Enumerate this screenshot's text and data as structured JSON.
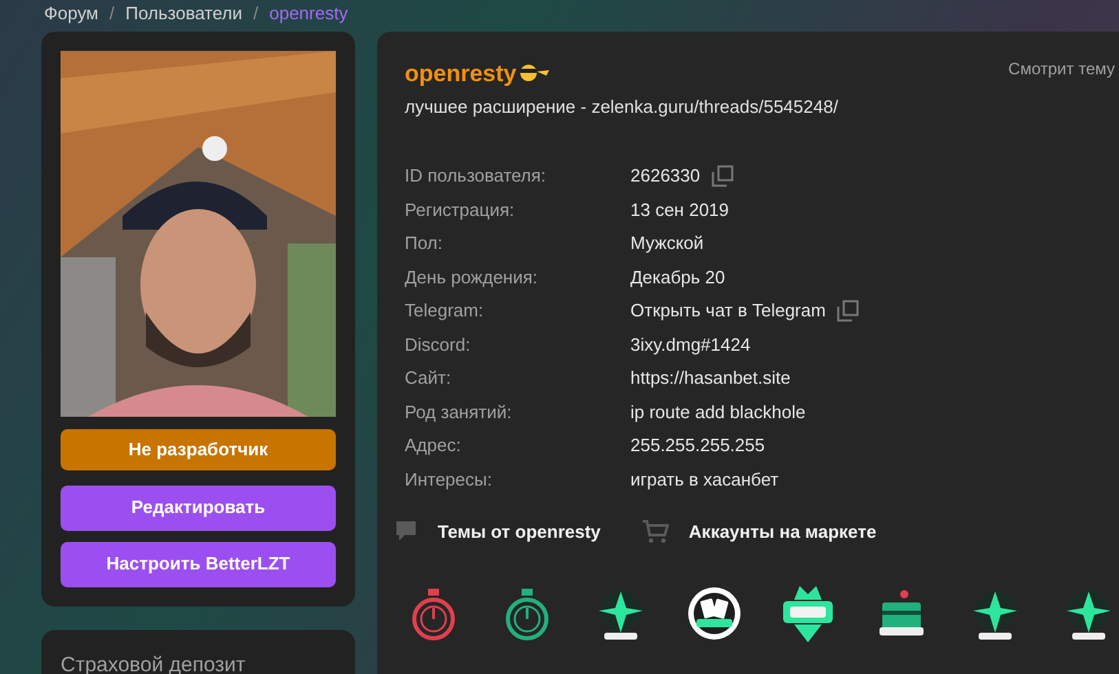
{
  "breadcrumb_separator": "/",
  "breadcrumbs": [
    {
      "label": "Форум",
      "selected": false
    },
    {
      "label": "Пользователи",
      "selected": false
    },
    {
      "label": "openresty",
      "selected": true
    }
  ],
  "sidebar": {
    "buttons": [
      {
        "label": "Не разработчик",
        "kind": "orange"
      },
      {
        "label": "Редактировать",
        "kind": "purple"
      },
      {
        "label": "Настроить BetterLZT",
        "kind": "purple"
      }
    ],
    "deposit_title": "Страховой депозит"
  },
  "profile": {
    "username": "openresty",
    "status": "лучшее расширение - zelenka.guru/threads/5545248/",
    "activity": "Смотрит тему",
    "fields": [
      {
        "label": "ID пользователя:",
        "value": "2626330",
        "copyable": true
      },
      {
        "label": "Регистрация:",
        "value": "13 сен 2019",
        "copyable": false
      },
      {
        "label": "Пол:",
        "value": "Мужской",
        "copyable": false
      },
      {
        "label": "День рождения:",
        "value": "Декабрь 20",
        "copyable": false
      },
      {
        "label": "Telegram:",
        "value": "Открыть чат в Telegram",
        "copyable": true
      },
      {
        "label": "Discord:",
        "value": "3ixy.dmg#1424",
        "copyable": false
      },
      {
        "label": "Сайт:",
        "value": "https://hasanbet.site",
        "copyable": false
      },
      {
        "label": "Род занятий:",
        "value": "ip route add blackhole",
        "copyable": false
      },
      {
        "label": "Адрес:",
        "value": "255.255.255.255",
        "copyable": false
      },
      {
        "label": "Интересы:",
        "value": "играть в хасанбет",
        "copyable": false
      }
    ],
    "links": [
      {
        "label": "Темы от openresty",
        "kind": "chat"
      },
      {
        "label": "Аккаунты на маркете",
        "kind": "cart"
      }
    ],
    "badges": [
      {
        "kind": "stopwatch",
        "color": "#e0404e"
      },
      {
        "kind": "stopwatch",
        "color": "#22b07d"
      },
      {
        "kind": "years",
        "color": "#2ee59d"
      },
      {
        "kind": "cards",
        "color": "#ffffff"
      },
      {
        "kind": "trophy",
        "color": "#2ee59d"
      },
      {
        "kind": "cake",
        "color": "#22b07d"
      },
      {
        "kind": "years",
        "color": "#2ee59d"
      },
      {
        "kind": "years",
        "color": "#2ee59d"
      }
    ]
  }
}
